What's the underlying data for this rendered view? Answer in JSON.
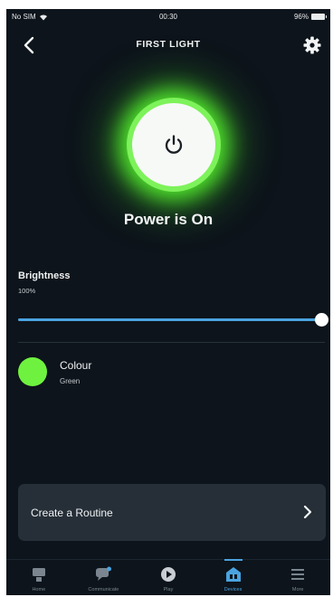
{
  "status": {
    "carrier": "No SIM",
    "time": "00:30",
    "battery": "96%"
  },
  "header": {
    "title": "FIRST LIGHT"
  },
  "power": {
    "state_label": "Power is On"
  },
  "brightness": {
    "label": "Brightness",
    "value": "100%",
    "level": 1.0
  },
  "colour": {
    "label": "Colour",
    "value": "Green",
    "swatch": "#6ff23f"
  },
  "routine": {
    "label": "Create a Routine"
  },
  "nav": {
    "items": [
      {
        "label": "Home",
        "icon": "home-icon"
      },
      {
        "label": "Communicate",
        "icon": "chat-icon"
      },
      {
        "label": "Play",
        "icon": "play-icon"
      },
      {
        "label": "Devices",
        "icon": "devices-icon"
      },
      {
        "label": "More",
        "icon": "menu-icon"
      }
    ],
    "active": "Devices"
  },
  "colors": {
    "accent": "#4aa3df",
    "glow": "#4fe02c",
    "background": "#0d141b"
  }
}
